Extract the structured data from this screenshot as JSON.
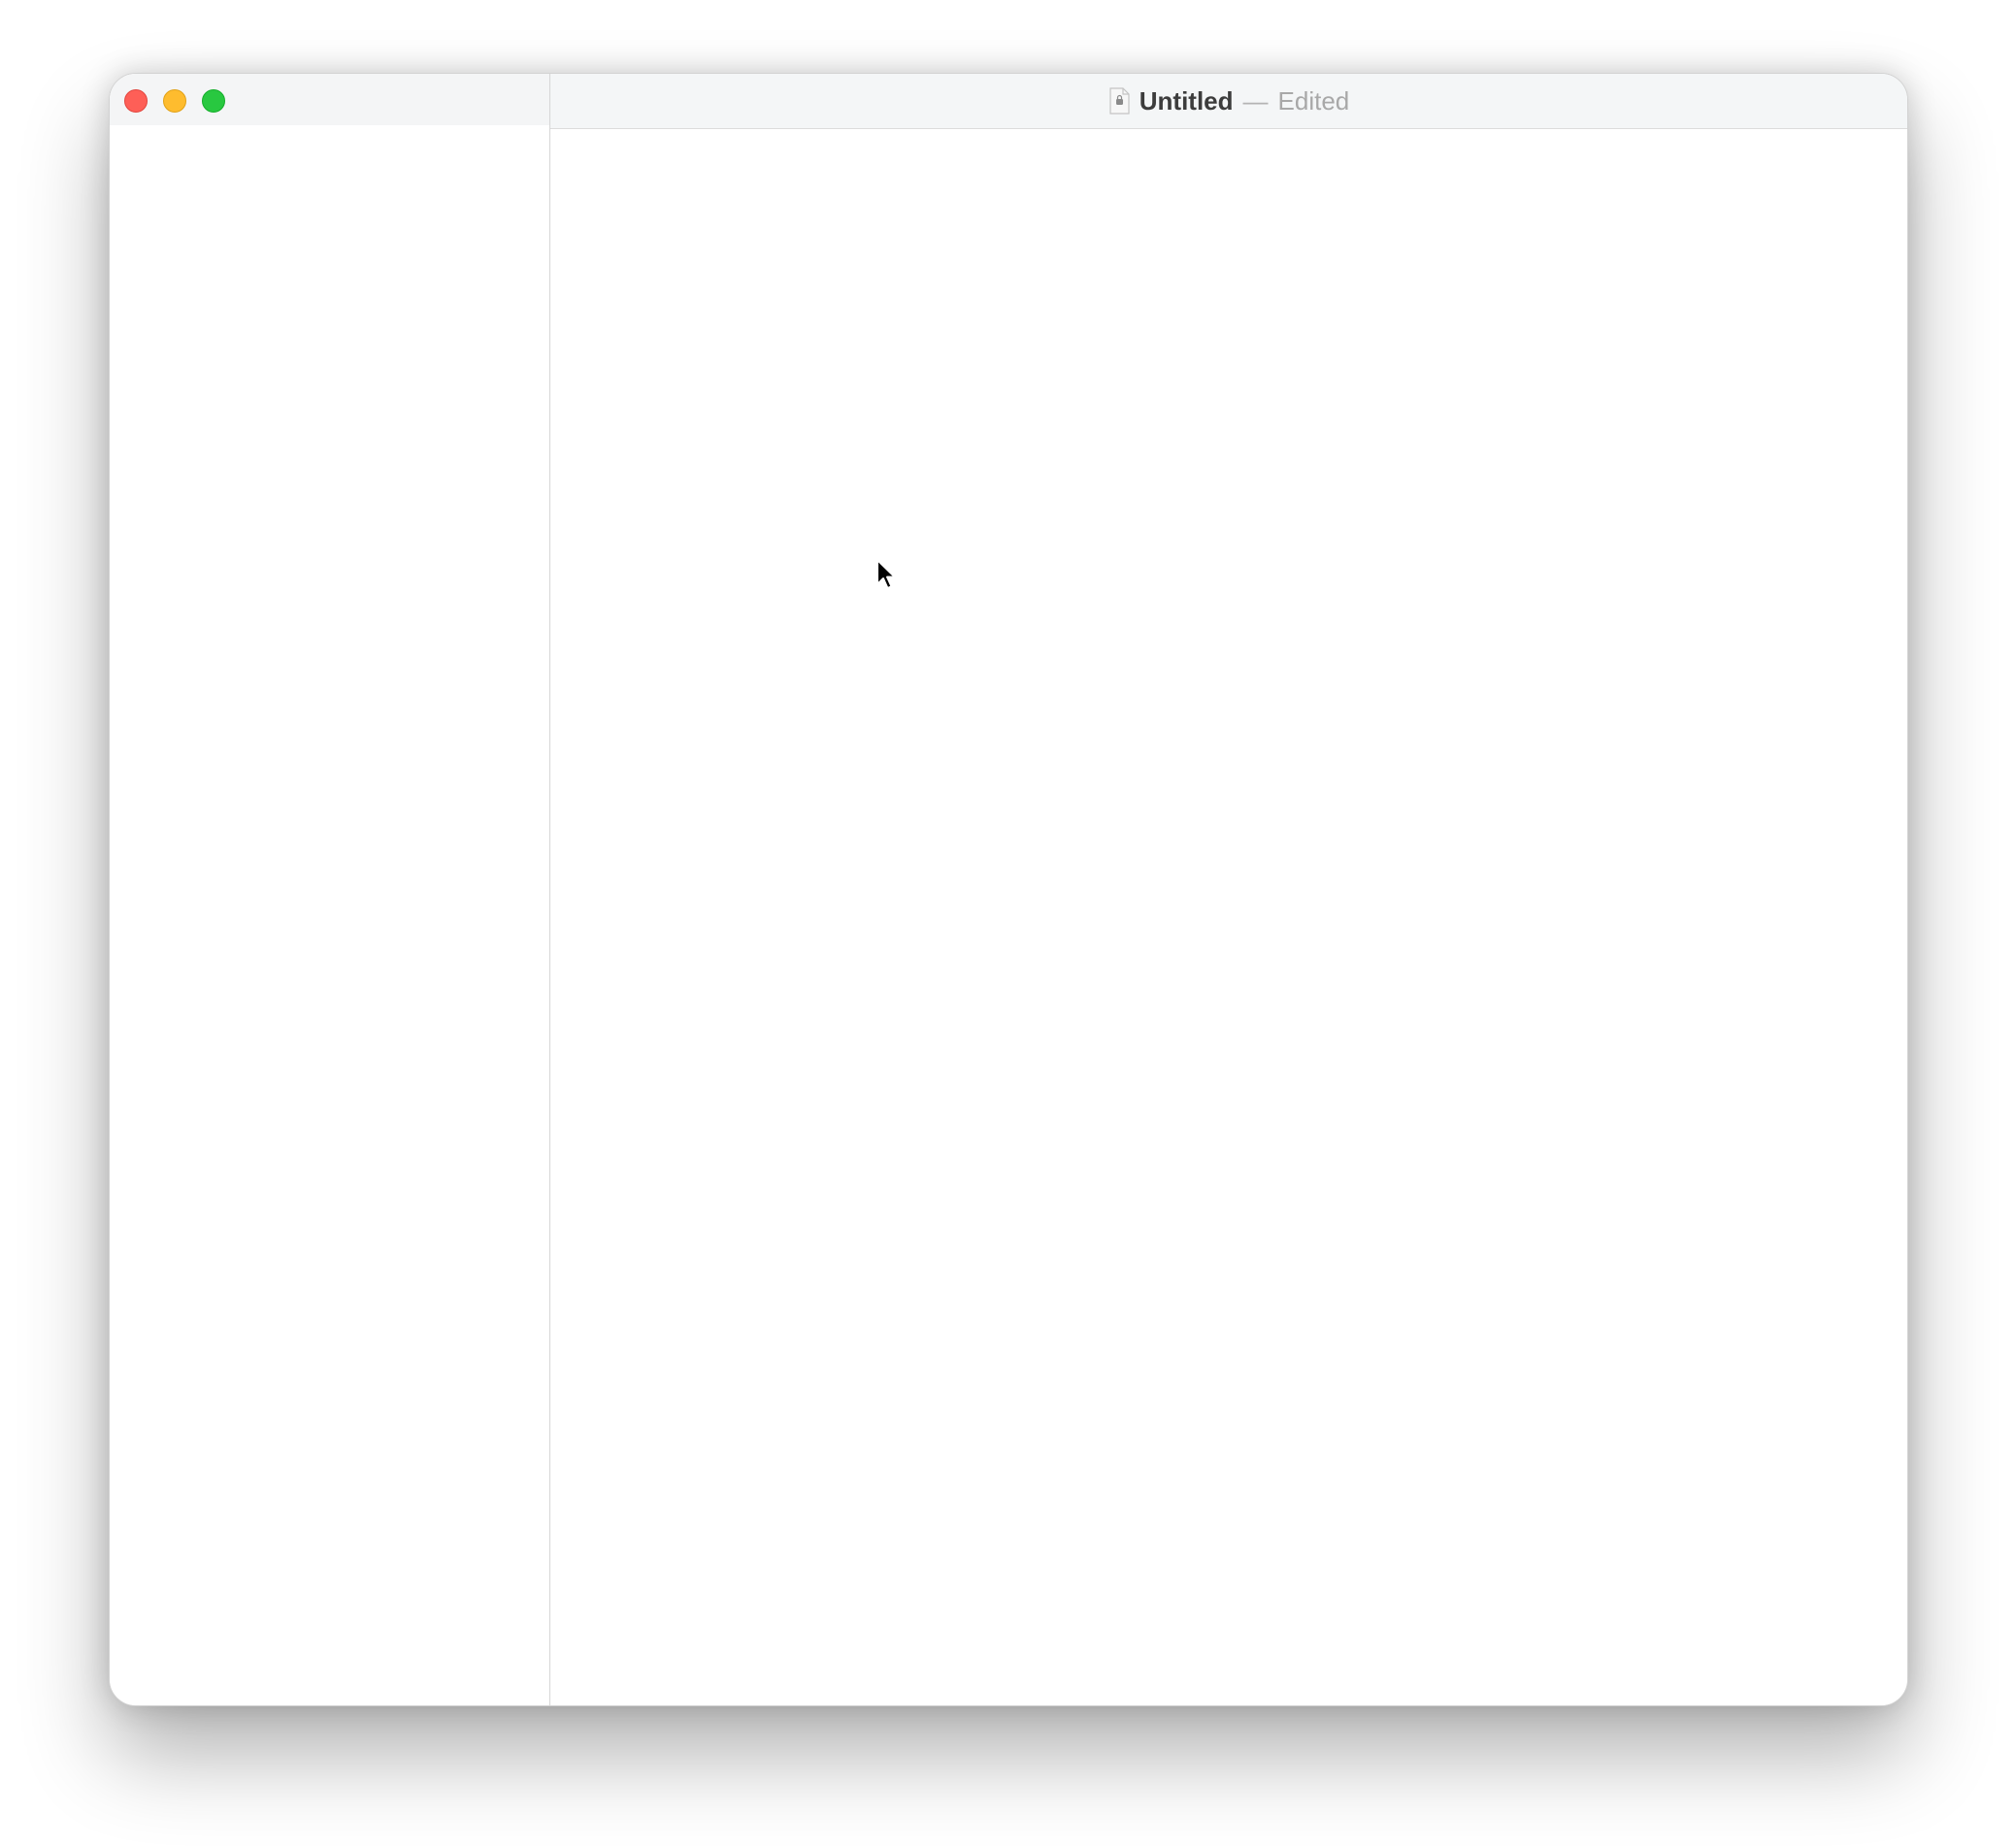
{
  "window": {
    "title": "Untitled",
    "separator": "—",
    "status": "Edited"
  },
  "traffic_lights": {
    "close_color": "#fe5f57",
    "minimize_color": "#febc2e",
    "zoom_color": "#28c840"
  },
  "icons": {
    "document": "document-icon",
    "cursor": "mouse-pointer-icon"
  }
}
